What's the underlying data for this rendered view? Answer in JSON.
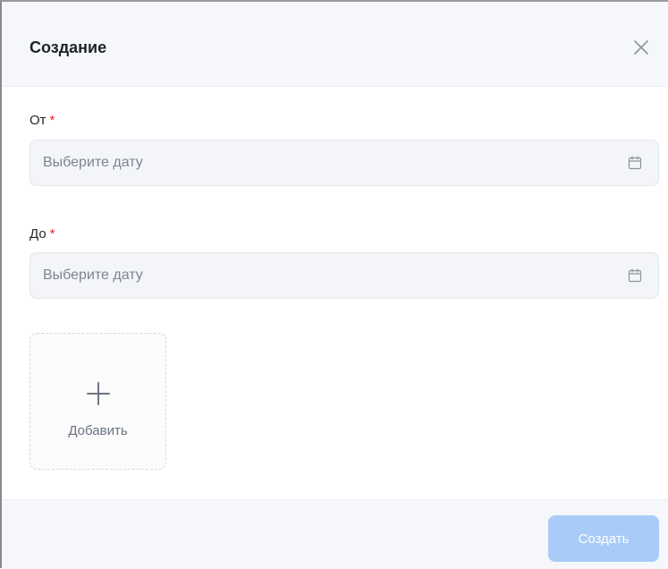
{
  "dialog": {
    "title": "Создание"
  },
  "form": {
    "from": {
      "label": "От",
      "required_mark": "*",
      "placeholder": "Выберите дату",
      "value": ""
    },
    "to": {
      "label": "До",
      "required_mark": "*",
      "placeholder": "Выберите дату",
      "value": ""
    },
    "upload": {
      "label": "Добавить"
    }
  },
  "footer": {
    "create_label": "Создать",
    "create_disabled": true
  },
  "colors": {
    "accent_disabled": "#a9cbf7",
    "required": "#f5222d",
    "header_bg": "#f5f7fa"
  },
  "icons": {
    "close": "close-icon",
    "calendar": "calendar-icon",
    "plus": "plus-icon"
  }
}
